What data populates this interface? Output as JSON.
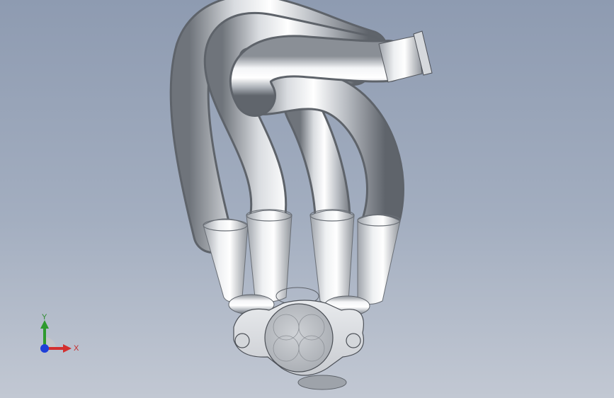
{
  "viewport": {
    "background_top": "#8e9bb1",
    "background_bottom": "#c2c8d3",
    "model": "exhaust-header"
  },
  "triad": {
    "x_label": "X",
    "y_label": "Y",
    "x_color": "#d32f2f",
    "y_color": "#2e9a2e",
    "z_color": "#1e3fd8"
  }
}
